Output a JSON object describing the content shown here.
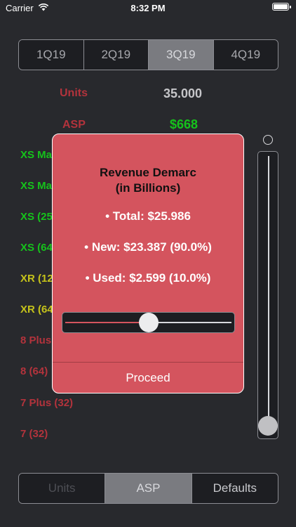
{
  "status_bar": {
    "carrier": "Carrier",
    "time": "8:32 PM"
  },
  "quarter_tabs": [
    {
      "label": "1Q19",
      "selected": false
    },
    {
      "label": "2Q19",
      "selected": false
    },
    {
      "label": "3Q19",
      "selected": true
    },
    {
      "label": "4Q19",
      "selected": false
    }
  ],
  "metrics": {
    "units_label": "Units",
    "units_value": "35.000",
    "asp_label": "ASP",
    "asp_value": "$668"
  },
  "models": [
    {
      "label": "XS Max",
      "color": "green"
    },
    {
      "label": "XS Max",
      "color": "green"
    },
    {
      "label": "XS (256)",
      "color": "green"
    },
    {
      "label": "XS (64)",
      "color": "green"
    },
    {
      "label": "XR (128)",
      "color": "yellow"
    },
    {
      "label": "XR (64)",
      "color": "yellow"
    },
    {
      "label": "8 Plus",
      "color": "red"
    },
    {
      "label": "8 (64)",
      "color": "red"
    },
    {
      "label": "7 Plus (32)",
      "color": "red"
    },
    {
      "label": "7 (32)",
      "color": "red"
    }
  ],
  "modal": {
    "title_line1": "Revenue Demarc",
    "title_line2": "(in Billions)",
    "total": "• Total: $25.986",
    "new": "• New: $23.387 (90.0%)",
    "used": "• Used: $2.599 (10.0%)",
    "slider_value": 0.5,
    "proceed_label": "Proceed"
  },
  "vertical_slider_value": 0.0,
  "bottom_tabs": [
    {
      "label": "Units",
      "state": "disabled"
    },
    {
      "label": "ASP",
      "state": "selected"
    },
    {
      "label": "Defaults",
      "state": "normal"
    }
  ],
  "colors": {
    "background": "#28292d",
    "modal": "#d4545e",
    "green": "#15c31b",
    "yellow": "#c5c21a",
    "red": "#b3333c"
  }
}
